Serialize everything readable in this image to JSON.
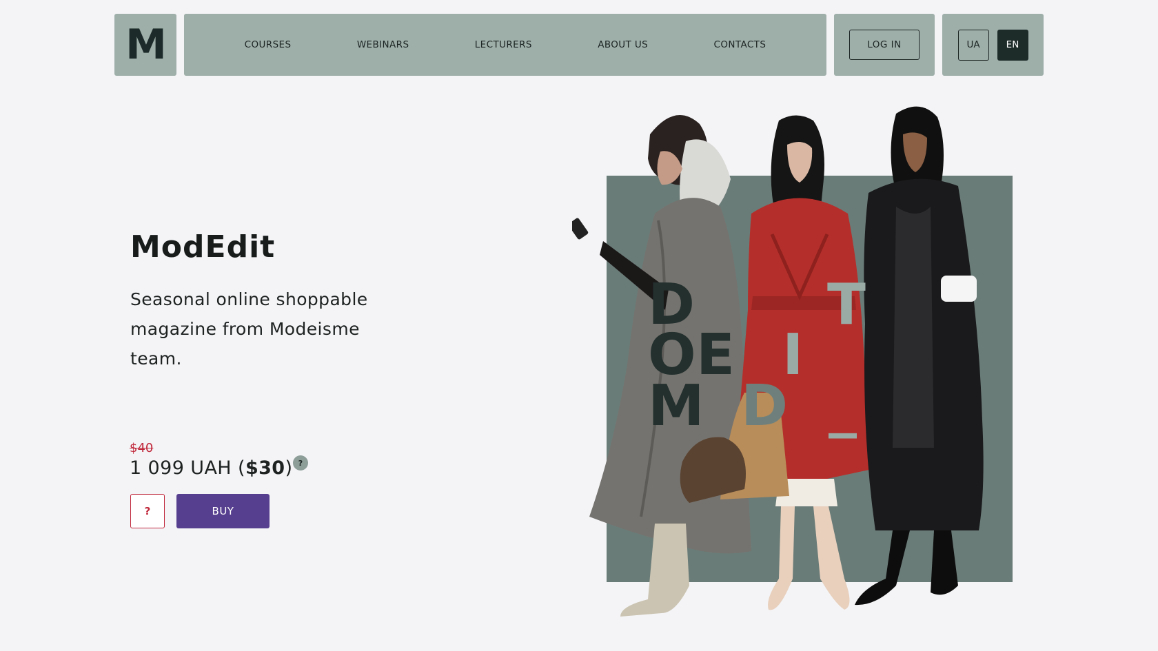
{
  "logo": {
    "letter": "M"
  },
  "nav": {
    "items": [
      "COURSES",
      "WEBINARS",
      "LECTURERS",
      "ABOUT US",
      "CONTACTS"
    ]
  },
  "auth": {
    "login_label": "LOG IN"
  },
  "lang": {
    "ua": "UA",
    "en": "EN",
    "active": "EN"
  },
  "hero": {
    "title": "ModEdit",
    "subtitle": "Seasonal online shoppable magazine from Modeisme team.",
    "old_price": "$40",
    "price_uah": "1 099 UAH (",
    "price_usd": "$30",
    "price_close": ")",
    "help_mark": "?",
    "question_button": "?",
    "buy_button": "BUY",
    "image_letters": {
      "d": "D",
      "t": "T",
      "o": "O",
      "e": "E",
      "i": "I",
      "m": "M",
      "d2": "D",
      "underscore": "_"
    }
  },
  "colors": {
    "header_bg": "#9eaea9",
    "accent_dark": "#1d2b29",
    "buy_purple": "#573f8f",
    "sale_red": "#c0283b",
    "image_panel": "#6a7c78"
  }
}
